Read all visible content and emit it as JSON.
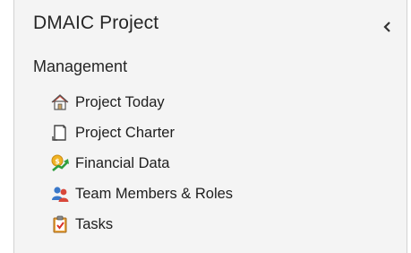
{
  "panel": {
    "title": "DMAIC Project",
    "collapse_icon": "chevron-left-icon"
  },
  "section": {
    "title": "Management",
    "items": [
      {
        "label": "Project Today",
        "icon": "house-icon"
      },
      {
        "label": "Project Charter",
        "icon": "document-icon"
      },
      {
        "label": "Financial Data",
        "icon": "financial-chart-icon"
      },
      {
        "label": "Team Members & Roles",
        "icon": "team-members-icon"
      },
      {
        "label": "Tasks",
        "icon": "clipboard-checklist-icon"
      }
    ]
  },
  "colors": {
    "panel_background": "#f4f4f4",
    "border": "#d2d2d2",
    "text": "#262626"
  }
}
